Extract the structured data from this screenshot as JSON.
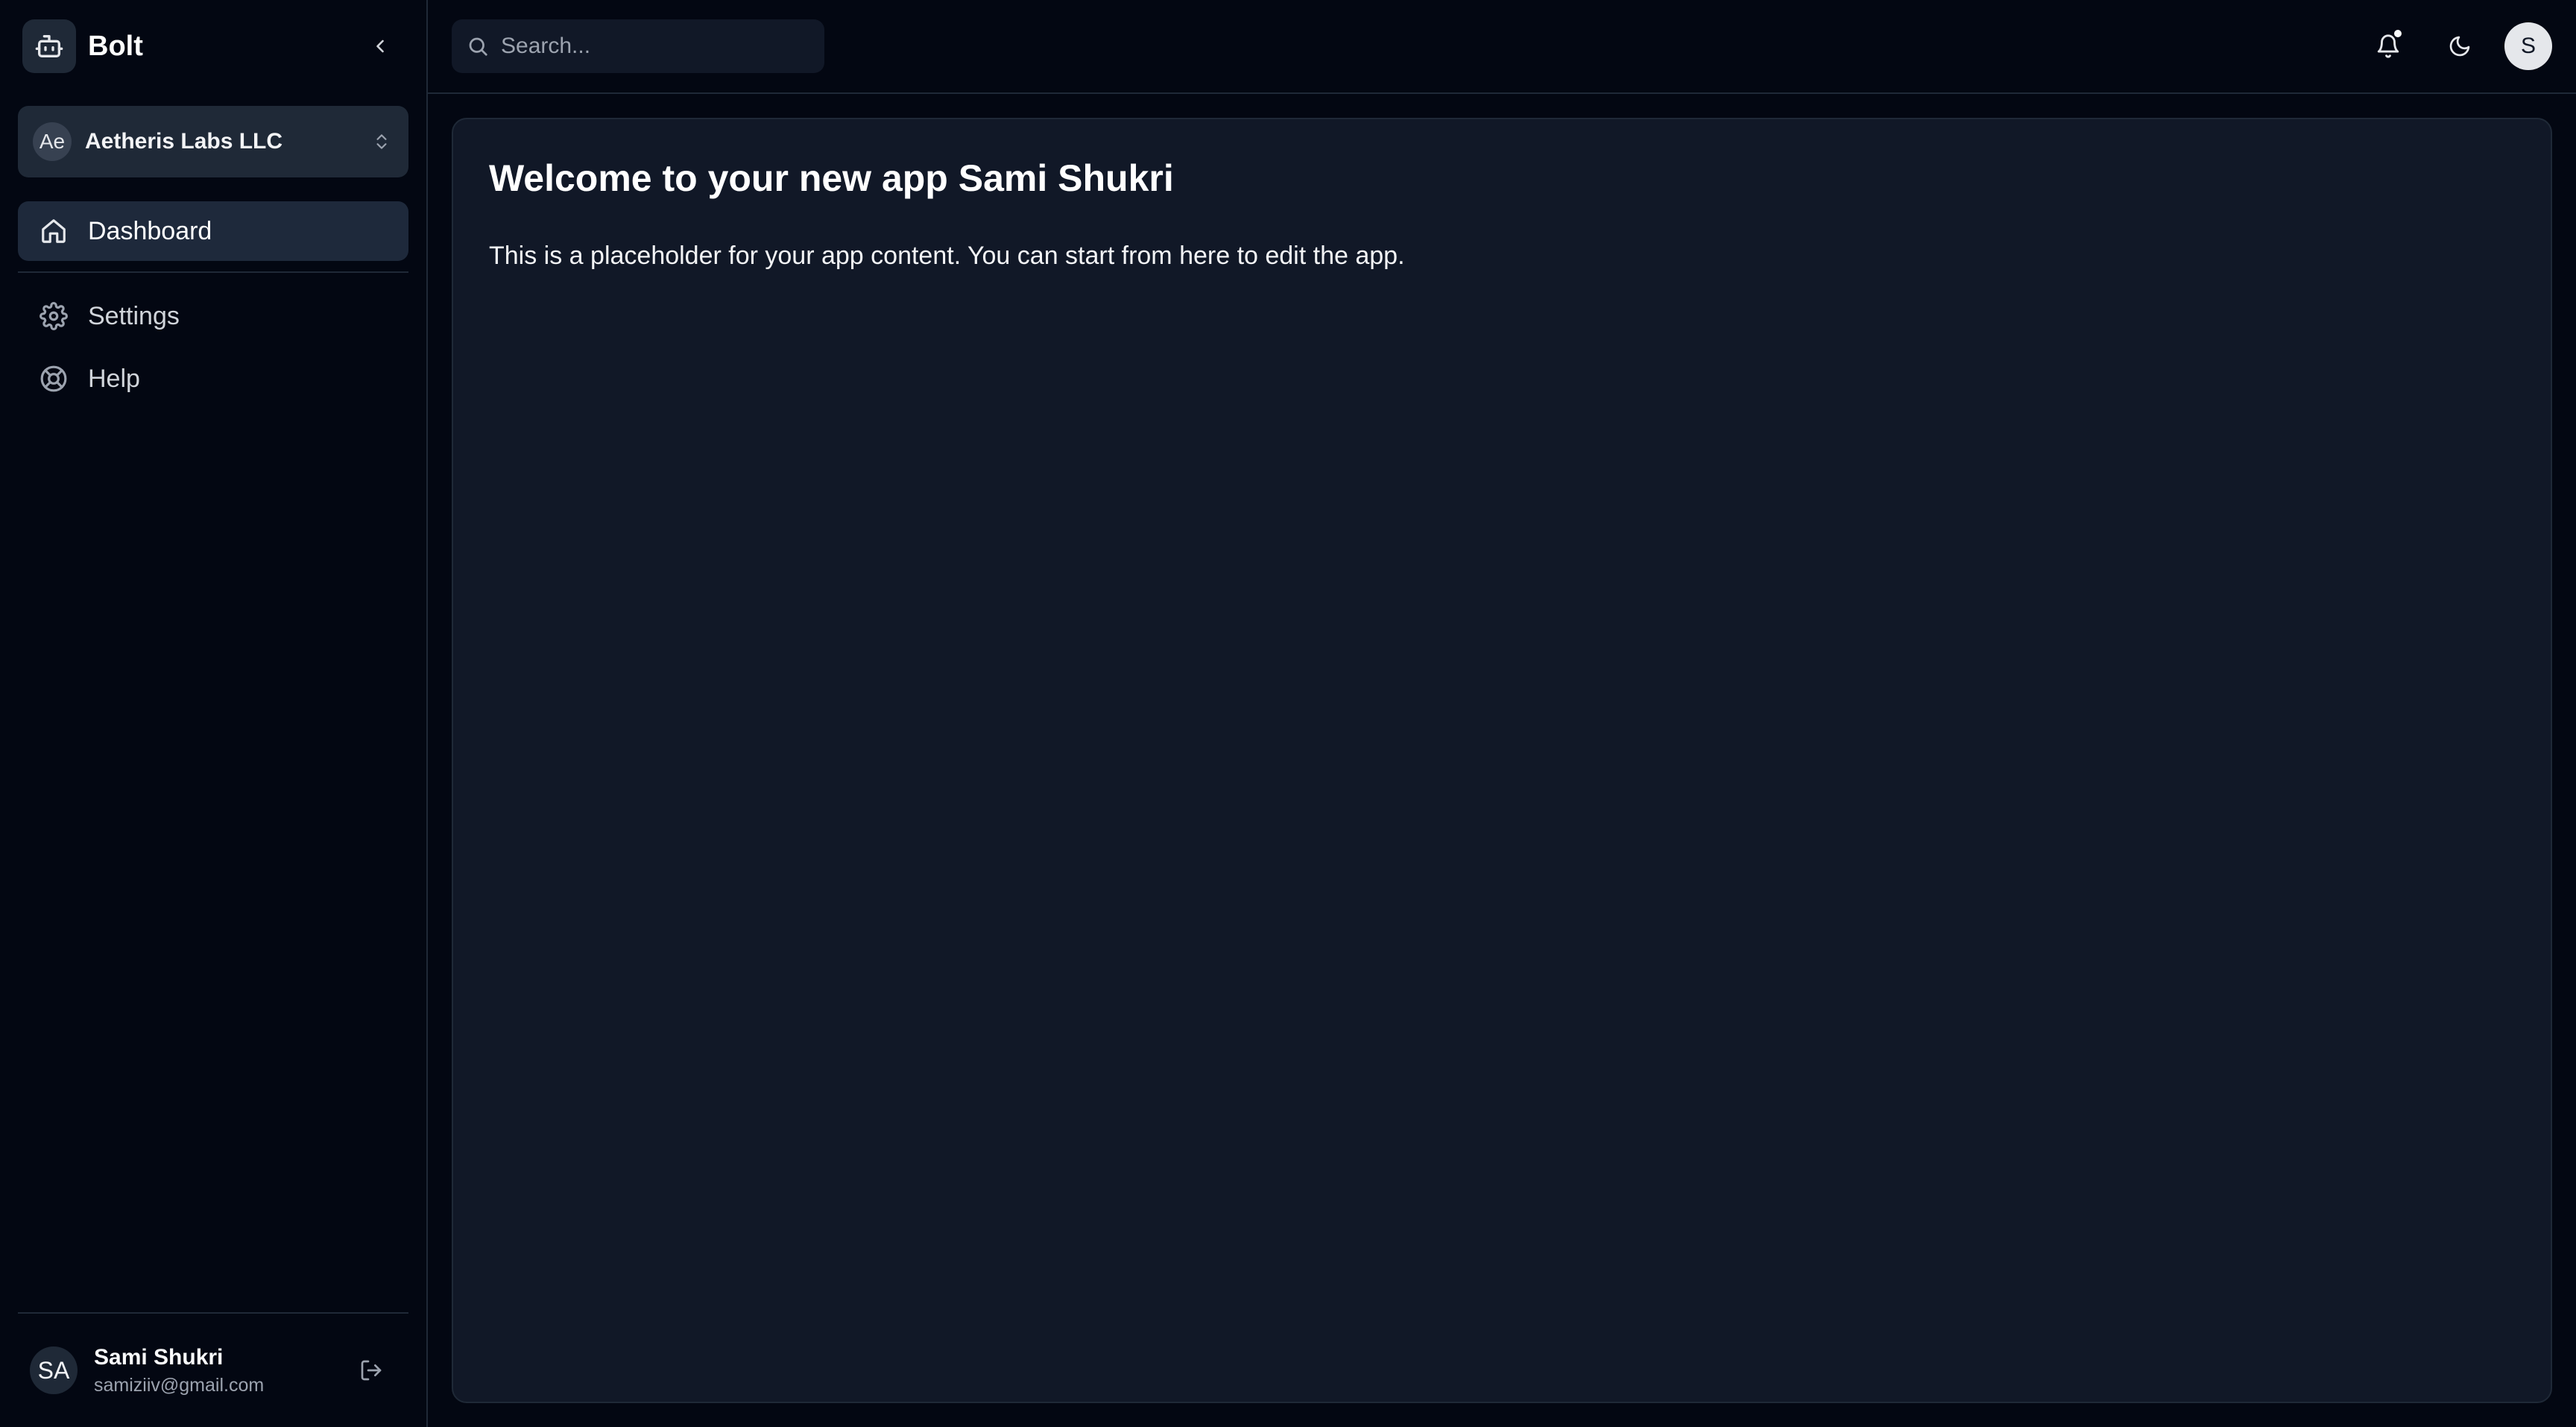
{
  "brand": {
    "name": "Bolt",
    "icon": "bot-icon"
  },
  "org": {
    "initials": "Ae",
    "name": "Aetheris Labs LLC"
  },
  "nav": {
    "items": [
      {
        "label": "Dashboard",
        "icon": "home-icon",
        "active": true
      },
      {
        "label": "Settings",
        "icon": "gear-icon",
        "active": false
      },
      {
        "label": "Help",
        "icon": "lifebuoy-icon",
        "active": false
      }
    ]
  },
  "user": {
    "initials": "SA",
    "name": "Sami Shukri",
    "email": "samiziiv@gmail.com"
  },
  "topbar": {
    "search_placeholder": "Search...",
    "profile_initial": "S"
  },
  "main": {
    "title": "Welcome to your new app Sami Shukri",
    "body": "This is a placeholder for your app content. You can start from here to edit the app."
  },
  "colors": {
    "background": "#030712",
    "card": "#111827",
    "active_nav": "#1e293b",
    "border": "#1f2937"
  }
}
